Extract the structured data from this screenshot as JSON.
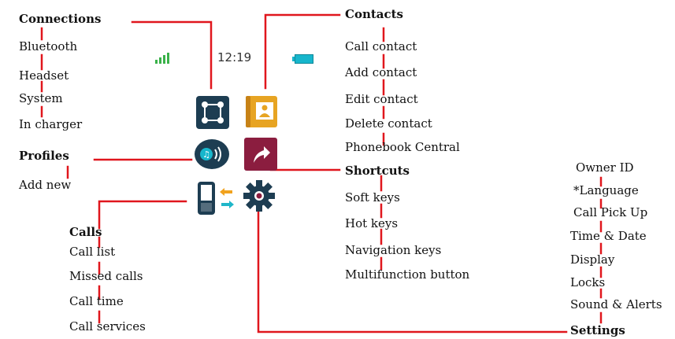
{
  "colors": {
    "line": "#e0161d",
    "icon_dark": "#1d3d52",
    "contacts": "#e7a422",
    "shortcuts": "#8b1d3f",
    "battery": "#17b6cc",
    "signal": "#3ab24a",
    "arrows_left": "#f1a21e",
    "arrows_right": "#1fb6c9"
  },
  "phone": {
    "time": "12:19",
    "icons": [
      "connections-icon",
      "contacts-book-icon",
      "profiles-sound-icon",
      "shortcut-arrow-icon",
      "calls-phone-icon",
      "settings-gear-icon"
    ]
  },
  "connections": {
    "title": "Connections",
    "items": [
      "Bluetooth",
      "Headset",
      "System",
      "In charger"
    ]
  },
  "profiles": {
    "title": "Profiles",
    "items": [
      "Add new"
    ]
  },
  "calls": {
    "title": "Calls",
    "items": [
      "Call list",
      "Missed calls",
      "Call time",
      "Call services"
    ]
  },
  "contacts": {
    "title": "Contacts",
    "items": [
      "Call contact",
      "Add contact",
      "Edit contact",
      "Delete contact",
      "Phonebook Central"
    ]
  },
  "shortcuts": {
    "title": "Shortcuts",
    "items": [
      "Soft keys",
      "Hot keys",
      "Navigation keys",
      "Multifunction button"
    ]
  },
  "settings": {
    "title": "Settings",
    "items": [
      "Owner ID",
      "*Language",
      "Call Pick Up",
      "Time & Date",
      "Display",
      "Locks",
      "Sound & Alerts"
    ]
  }
}
